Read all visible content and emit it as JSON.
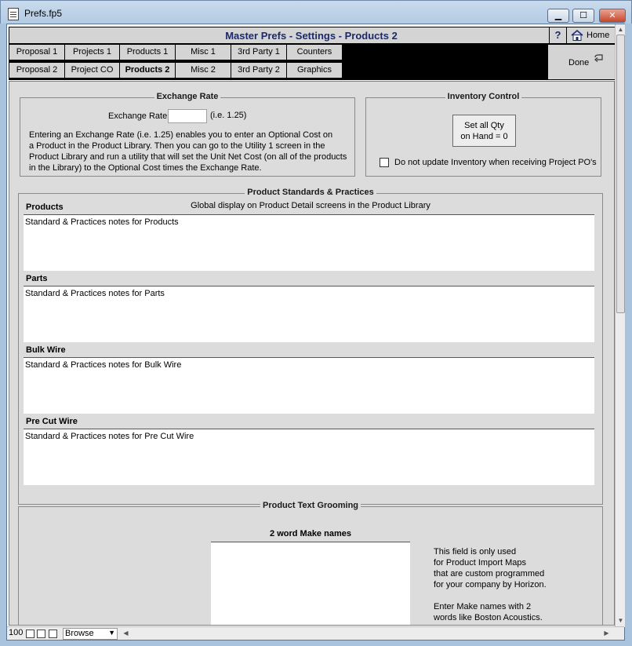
{
  "window": {
    "title": "Prefs.fp5",
    "min_glyph": "▁",
    "max_glyph": "☐",
    "close_glyph": "✕"
  },
  "header": {
    "title": "Master Prefs - Settings - Products 2",
    "help_label": "?",
    "home_label": "Home"
  },
  "tabs": {
    "row1": [
      "Proposal 1",
      "Projects 1",
      "Products 1",
      "Misc 1",
      "3rd Party 1",
      "Counters"
    ],
    "row2": [
      "Proposal 2",
      "Project CO",
      "Products 2",
      "Misc 2",
      "3rd Party 2",
      "Graphics"
    ],
    "active": "Products 2"
  },
  "done": {
    "label": "Done"
  },
  "exchange": {
    "title": "Exchange Rate",
    "field_label": "Exchange Rate",
    "field_value": "",
    "hint": "(i.e. 1.25)",
    "desc": [
      "Entering an Exchange Rate (i.e. 1.25) enables you to enter an Optional Cost on",
      "a Product in the Product Library. Then you can go to the Utility 1 screen in the",
      "Product Library and run a utility that will set the Unit Net Cost (on all of the products",
      "in the Library) to the Optional Cost times the Exchange Rate."
    ]
  },
  "inventory": {
    "title": "Inventory Control",
    "button_line1": "Set all Qty",
    "button_line2": "on Hand = 0",
    "checkbox_label": "Do not update Inventory when receiving Project PO's",
    "checkbox_checked": false
  },
  "standards": {
    "title": "Product Standards & Practices",
    "subtitle": "Global display on Product Detail screens in the Product Library",
    "sections": [
      {
        "label": "Products",
        "note": "Standard & Practices notes for Products"
      },
      {
        "label": "Parts",
        "note": "Standard & Practices notes for Parts"
      },
      {
        "label": "Bulk Wire",
        "note": "Standard & Practices notes for Bulk Wire"
      },
      {
        "label": "Pre Cut Wire",
        "note": "Standard & Practices notes for Pre Cut Wire"
      }
    ]
  },
  "grooming": {
    "title": "Product Text Grooming",
    "field_label": "2 word Make names",
    "field_value": "",
    "info": [
      "This field is only used",
      "for Product Import Maps",
      "that are custom programmed",
      "for your company by Horizon.",
      "",
      "Enter Make names with 2",
      "words like Boston Acoustics."
    ]
  },
  "statusbar": {
    "zoom": "100",
    "mode": "Browse"
  }
}
